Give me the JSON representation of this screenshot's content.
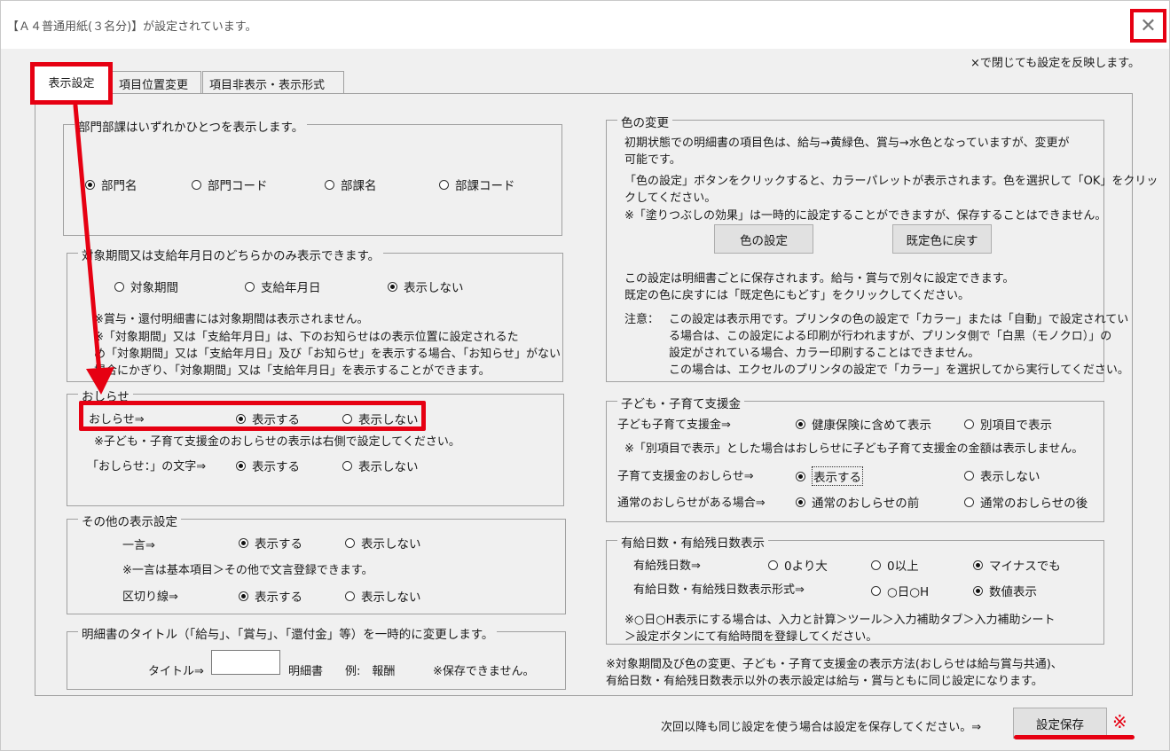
{
  "window": {
    "title": "【Ａ４普通用紙(３名分)】が設定されています。",
    "close_glyph": "✕",
    "hint": "×で閉じても設定を反映します。"
  },
  "tabs": [
    {
      "label": "表示設定",
      "active": true
    },
    {
      "label": "項目位置変更"
    },
    {
      "label": "項目非表示・表示形式"
    }
  ],
  "dept": {
    "legend": "部門部課はいずれかひとつを表示します。",
    "options": [
      "部門名",
      "部門コード",
      "部課名",
      "部課コード"
    ],
    "selected": 0
  },
  "period": {
    "legend": "対象期間又は支給年月日のどちらかのみ表示できます。",
    "options": [
      "対象期間",
      "支給年月日",
      "表示しない"
    ],
    "selected": 2,
    "notes": [
      "※賞与・還付明細書には対象期間は表示されません。",
      "※「対象期間」又は「支給年月日」は、下のお知らせはの表示位置に設定されるた",
      "め「対象期間」又は「支給年月日」及び「お知らせ」を表示する場合、「お知らせ」がない",
      "場合にかぎり、「対象期間」又は「支給年月日」を表示することができます。"
    ]
  },
  "notice": {
    "legend": "おしらせ",
    "row1_label": "おしらせ⇒",
    "row1_on": "表示する",
    "row1_off": "表示しない",
    "note": "※子ども・子育て支援金のおしらせの表示は右側で設定してください。",
    "row2_label": "「おしらせ：」の文字⇒",
    "row2_on": "表示する",
    "row2_off": "表示しない"
  },
  "other": {
    "legend": "その他の表示設定",
    "row1_label": "一言⇒",
    "row1_on": "表示する",
    "row1_off": "表示しない",
    "note": "※一言は基本項目＞その他で文言登録できます。",
    "row2_label": "区切り線⇒",
    "row2_on": "表示する",
    "row2_off": "表示しない"
  },
  "titlechg": {
    "legend": "明細書のタイトル（「給与」、「賞与」、「還付金」等）を一時的に変更します。",
    "label": "タイトル⇒",
    "value": "",
    "suffix": "明細書",
    "example": "例:　報酬",
    "note": "※保存できません。"
  },
  "color": {
    "legend": "色の変更",
    "lines": [
      "初期状態での明細書の項目色は、給与→黄緑色、賞与→水色となっていますが、変更が",
      "可能です。",
      "「色の設定」ボタンをクリックすると、カラーパレットが表示されます。色を選択して「OK」をクリッ",
      "クしてください。",
      "※「塗りつぶしの効果」は一時的に設定することができますが、保存することはできません。"
    ],
    "btn_set": "色の設定",
    "btn_reset": "既定色に戻す",
    "lines2": [
      "この設定は明細書ごとに保存されます。給与・賞与で別々に設定できます。",
      "既定の色に戻すには「既定色にもどす」をクリックしてください。"
    ],
    "caution_label": "注意：",
    "caution": [
      "この設定は表示用です。プリンタの色の設定で「カラー」または「自動」で設定されてい",
      "る場合は、この設定による印刷が行われますが、プリンタ側で「白黒（モノクロ）」の",
      "設定がされている場合、カラー印刷することはできません。",
      "この場合は、エクセルのプリンタの設定で「カラー」を選択してから実行してください。"
    ]
  },
  "child": {
    "legend": "子ども・子育て支援金",
    "row1_label": "子ども子育て支援金⇒",
    "row1_a": "健康保険に含めて表示",
    "row1_b": "別項目で表示",
    "note": "※「別項目で表示」とした場合はおしらせに子ども子育て支援金の金額は表示しません。",
    "row2_label": "子育て支援金のおしらせ⇒",
    "row2_a": "表示する",
    "row2_b": "表示しない",
    "row3_label": "通常のおしらせがある場合⇒",
    "row3_a": "通常のおしらせの前",
    "row3_b": "通常のおしらせの後"
  },
  "leave": {
    "legend": "有給日数・有給残日数表示",
    "row1_label": "有給残日数⇒",
    "row1_a": "0より大",
    "row1_b": "0以上",
    "row1_c": "マイナスでも",
    "row2_label": "有給日数・有給残日数表示形式⇒",
    "row2_a": "○日○H",
    "row2_b": "数値表示",
    "note1": "※○日○H表示にする場合は、入力と計算＞ツール＞入力補助タブ＞入力補助シート",
    "note2": "＞設定ボタンにて有給時間を登録してください。"
  },
  "footnote": [
    "※対象期間及び色の変更、子ども・子育て支援金の表示方法(おしらせは給与賞与共通)、",
    "有給日数・有給残日数表示以外の表示設定は給与・賞与ともに同じ設定になります。"
  ],
  "footer": {
    "hint": "次回以降も同じ設定を使う場合は設定を保存してください。⇒",
    "save_btn": "設定保存",
    "mark": "※"
  },
  "colors": {
    "accent": "#e60012"
  }
}
